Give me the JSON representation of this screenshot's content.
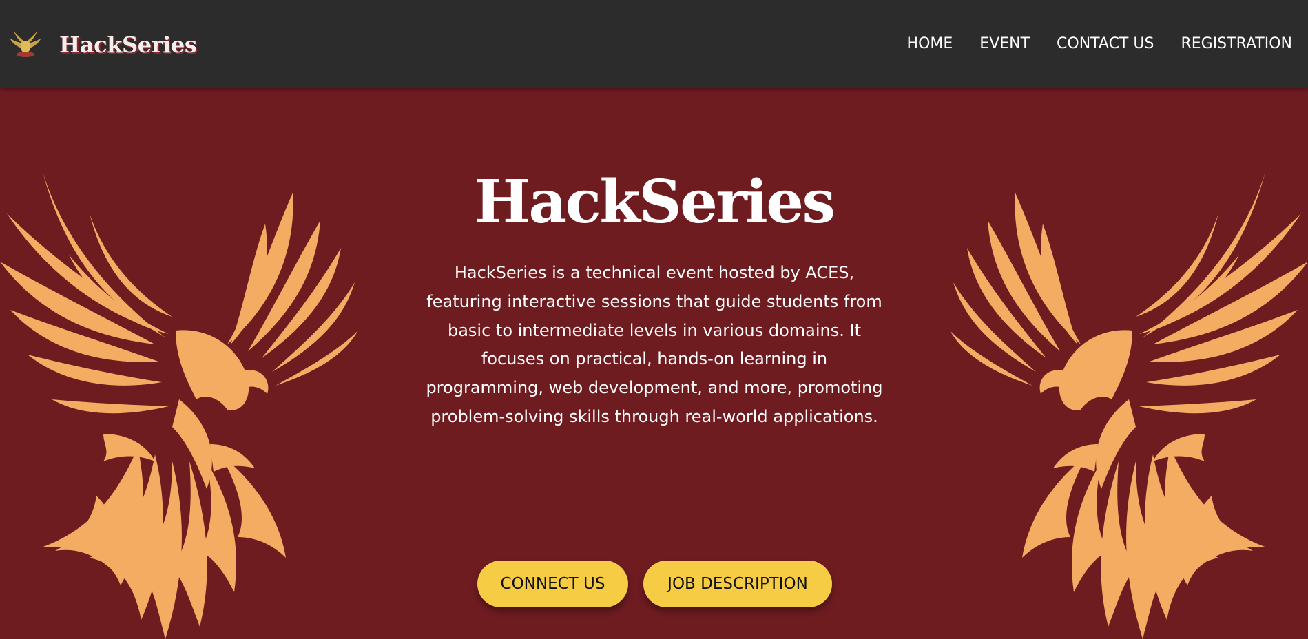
{
  "header": {
    "brand_name": "HackSeries",
    "logo_icon": "phoenix-emblem-icon",
    "nav": [
      "HOME",
      "EVENT",
      "CONTACT US",
      "REGISTRATION"
    ]
  },
  "hero": {
    "title": "HackSeries",
    "description": "HackSeries is a technical event hosted by ACES, featuring interactive sessions that guide students from basic to intermediate levels in various domains. It focuses on practical, hands-on learning in programming, web development, and more, promoting problem-solving skills through real-world applications.",
    "buttons": {
      "connect": "CONNECT US",
      "job_description": "JOB DESCRIPTION"
    },
    "decor_icon": "phoenix-icon"
  },
  "colors": {
    "header_bg": "#2c2c2c",
    "hero_bg": "#6f1c21",
    "accent_phoenix": "#f3ac62",
    "button_bg": "#f6cc45",
    "text_primary": "#ffffff"
  }
}
